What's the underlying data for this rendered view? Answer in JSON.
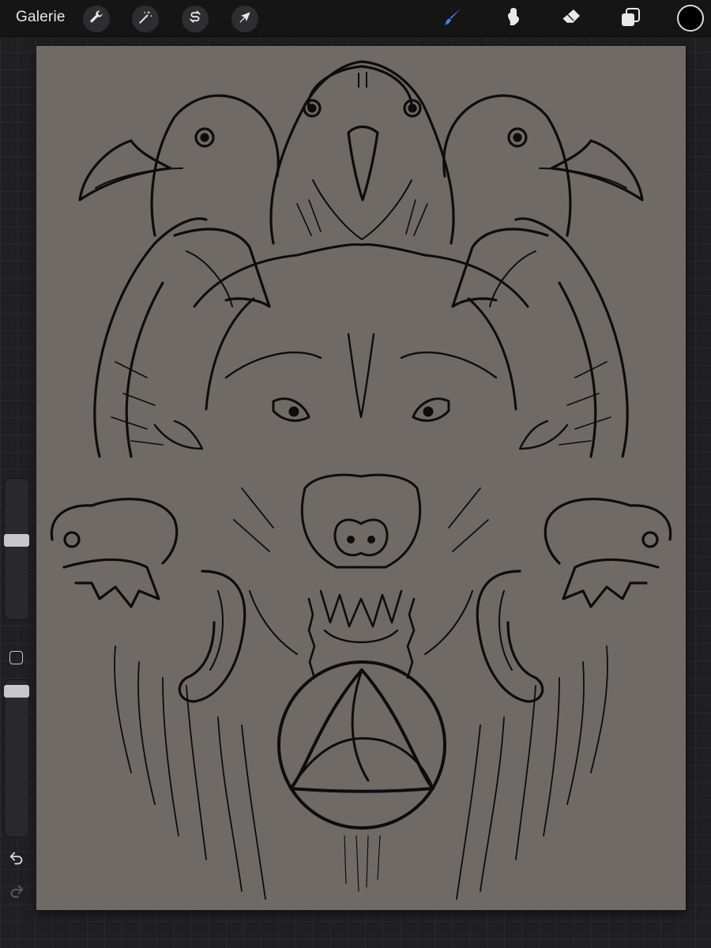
{
  "toolbar": {
    "gallery_label": "Galerie",
    "left_tools": [
      {
        "name": "wrench-icon",
        "action": "actions"
      },
      {
        "name": "magic-wand-icon",
        "action": "adjustments"
      },
      {
        "name": "selection-s-icon",
        "action": "selection"
      },
      {
        "name": "arrow-cursor-icon",
        "action": "transform"
      }
    ],
    "right_tools": [
      {
        "name": "brush-icon",
        "action": "paint",
        "active": true
      },
      {
        "name": "smudge-icon",
        "action": "smudge",
        "active": false
      },
      {
        "name": "eraser-icon",
        "action": "erase",
        "active": false
      },
      {
        "name": "layers-icon",
        "action": "layers",
        "active": false
      }
    ],
    "current_color": "#000000",
    "active_tool_color": "#3b82f6"
  },
  "canvas": {
    "background_color": "#6f6a66",
    "stroke_color": "#0d0d0d",
    "subject": "wolf-head-ravens-skulls-triquetra-lineart"
  },
  "sidebar": {
    "brush_size_level": 0.43,
    "opacity_level": 0.04,
    "modifier_icon": "square-modifier-icon",
    "undo_icon": "undo-icon",
    "redo_icon": "redo-icon",
    "redo_enabled": false
  }
}
